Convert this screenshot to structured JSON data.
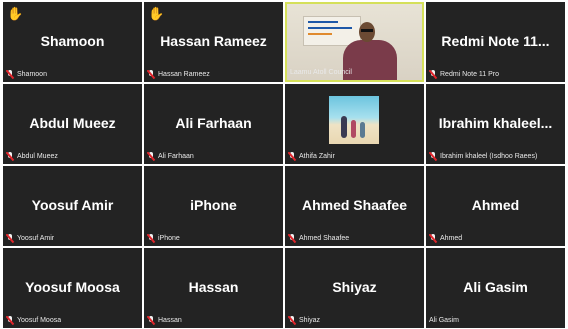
{
  "colors": {
    "tile_bg": "#232323",
    "active_border": "#d5e05a",
    "mute": "#e0252b",
    "hand": "#f4b400"
  },
  "participants": [
    {
      "display": "Shamoon",
      "label": "Shamoon",
      "muted": true,
      "hand_icon": "raised-hand-icon"
    },
    {
      "display": "Hassan Rameez",
      "label": "Hassan Rameez",
      "muted": true,
      "hand_icon": "raised-hand-icon"
    },
    {
      "display": "",
      "label": "Laamu Atoll Council",
      "muted": false,
      "video": true,
      "active_speaker": true
    },
    {
      "display": "Redmi Note 11...",
      "label": "Redmi Note 11 Pro",
      "muted": true
    },
    {
      "display": "Abdul Mueez",
      "label": "Abdul Mueez",
      "muted": true
    },
    {
      "display": "Ali Farhaan",
      "label": "Ali Farhaan",
      "muted": true
    },
    {
      "display": "",
      "label": "Athifa Zahir",
      "muted": true,
      "profile_picture": true
    },
    {
      "display": "Ibrahim  khaleel...",
      "label": "Ibrahim khaleel (Isdhoo Raees)",
      "muted": true
    },
    {
      "display": "Yoosuf Amir",
      "label": "Yoosuf Amir",
      "muted": true
    },
    {
      "display": "iPhone",
      "label": "iPhone",
      "muted": true
    },
    {
      "display": "Ahmed Shaafee",
      "label": "Ahmed Shaafee",
      "muted": true
    },
    {
      "display": "Ahmed",
      "label": "Ahmed",
      "muted": true
    },
    {
      "display": "Yoosuf Moosa",
      "label": "Yoosuf Moosa",
      "muted": true
    },
    {
      "display": "Hassan",
      "label": "Hassan",
      "muted": true
    },
    {
      "display": "Shiyaz",
      "label": "Shiyaz",
      "muted": true
    },
    {
      "display": "Ali Gasim",
      "label": "Ali Gasim",
      "muted": false
    }
  ]
}
